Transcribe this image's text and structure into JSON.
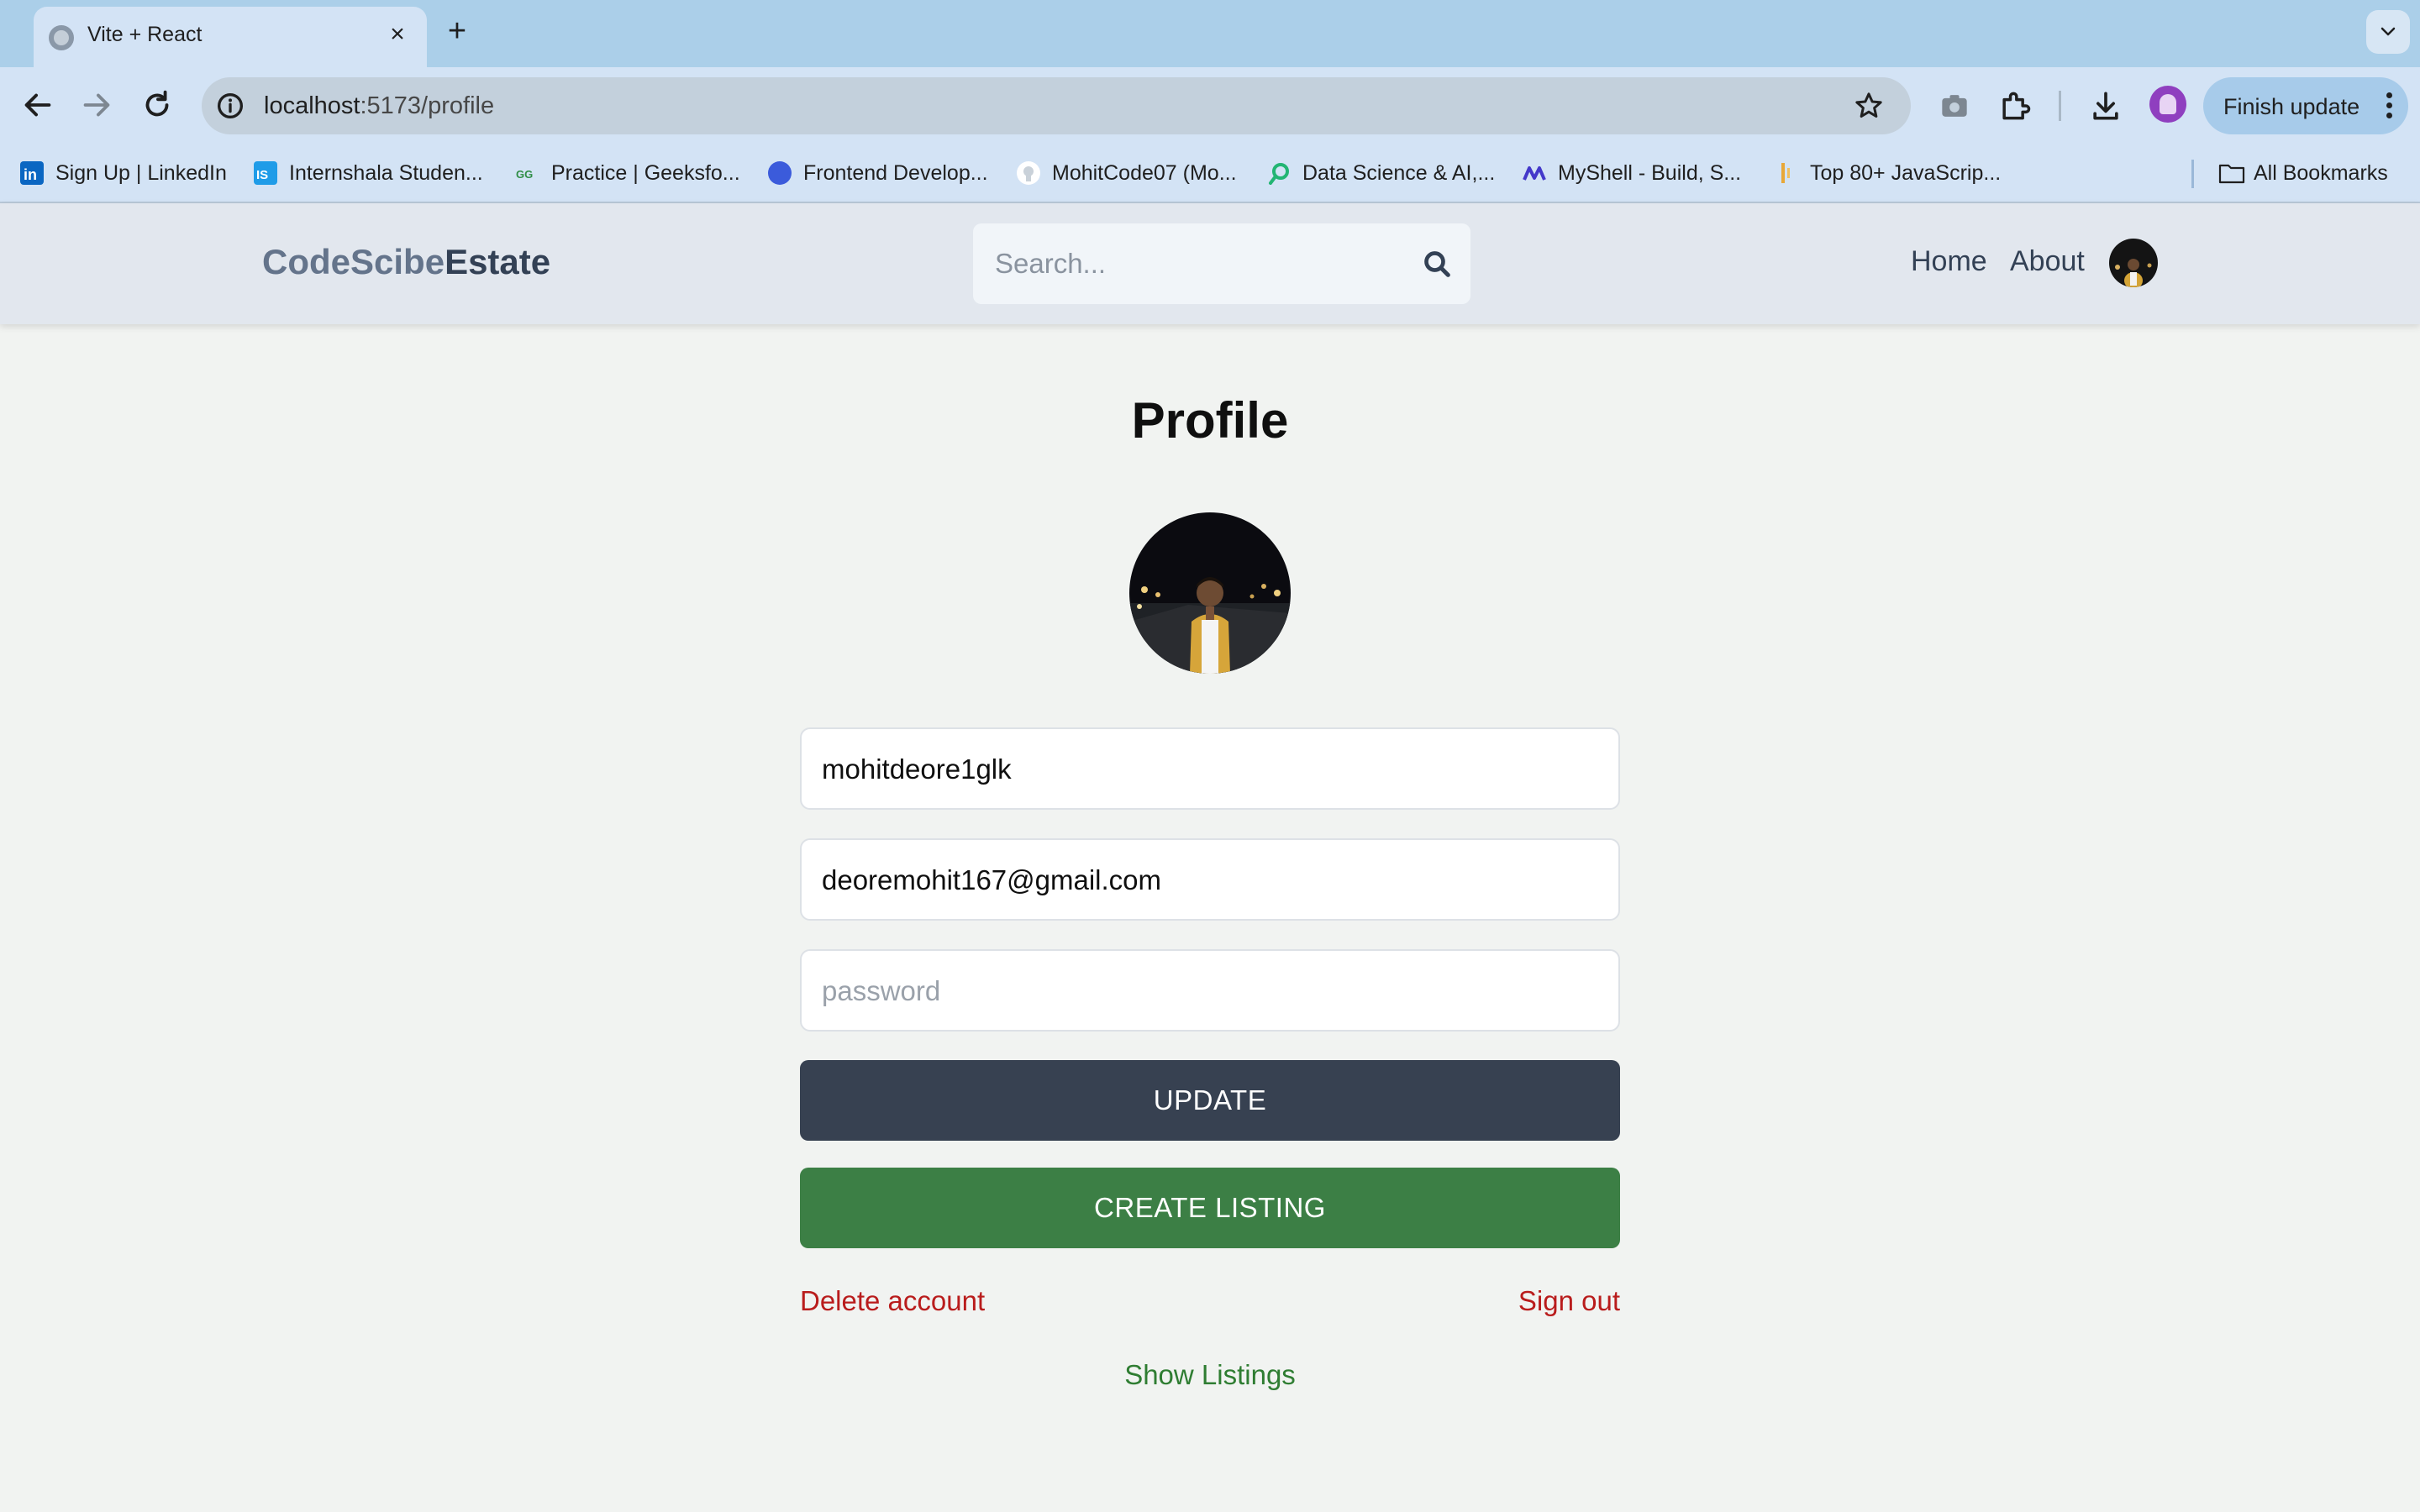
{
  "browser": {
    "tab_title": "Vite + React",
    "url_host": "localhost",
    "url_path": ":5173/profile",
    "finish_update_label": "Finish update",
    "bookmarks": [
      {
        "label": "Sign Up | LinkedIn",
        "icon": "linkedin-icon",
        "color": "#0a66c2"
      },
      {
        "label": "Internshala Studen...",
        "icon": "internshala-icon",
        "color": "#1f9ce8"
      },
      {
        "label": "Practice | Geeksfo...",
        "icon": "geeksforgeeks-icon",
        "color": "#2f8d46"
      },
      {
        "label": "Frontend Develop...",
        "icon": "frontend-icon",
        "color": "#3b5bdb"
      },
      {
        "label": "MohitCode07 (Mo...",
        "icon": "github-icon",
        "color": "#ffffff"
      },
      {
        "label": "Data Science & AI,...",
        "icon": "datascience-icon",
        "color": "#22b573"
      },
      {
        "label": "MyShell - Build, S...",
        "icon": "myshell-icon",
        "color": "#4338ca"
      },
      {
        "label": "Top 80+ JavaScrip...",
        "icon": "javascript-icon",
        "color": "#e8a838"
      }
    ],
    "all_bookmarks_label": "All Bookmarks"
  },
  "header": {
    "logo_part1": "CodeScibe",
    "logo_part2": "Estate",
    "search_placeholder": "Search...",
    "nav_home": "Home",
    "nav_about": "About"
  },
  "profile": {
    "title": "Profile",
    "username_value": "mohitdeore1glk",
    "email_value": "deoremohit167@gmail.com",
    "password_placeholder": "password",
    "update_label": "UPDATE",
    "create_listing_label": "CREATE LISTING",
    "delete_account_label": "Delete account",
    "sign_out_label": "Sign out",
    "show_listings_label": "Show Listings"
  },
  "colors": {
    "update_button": "#374151",
    "create_listing_button": "#3c7f45",
    "danger_text": "#b91c1c",
    "success_text": "#2f7d32"
  }
}
